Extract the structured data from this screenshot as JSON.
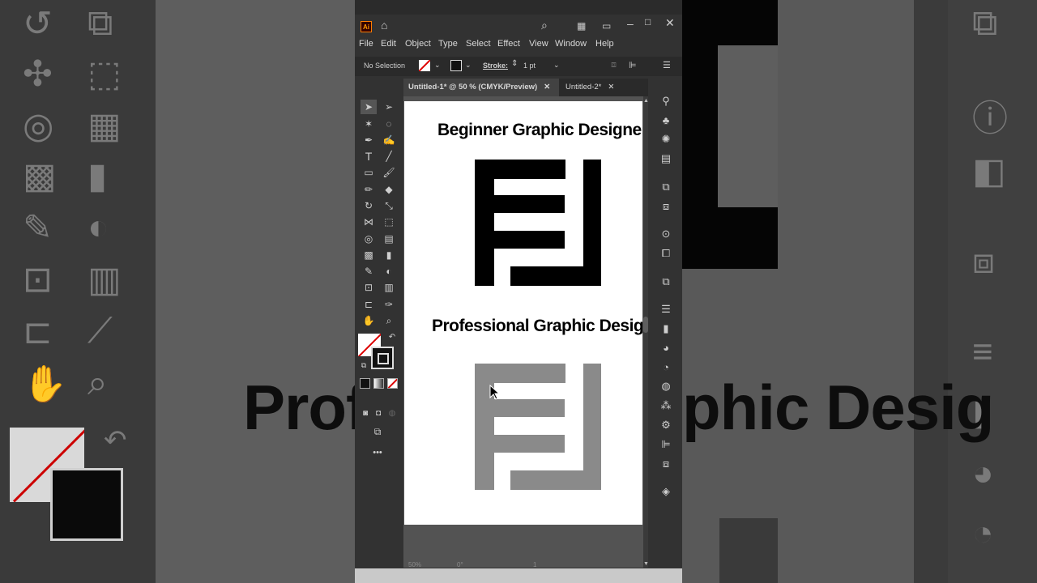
{
  "app": {
    "logo_text": "Ai",
    "menu": [
      "File",
      "Edit",
      "Object",
      "Type",
      "Select",
      "Effect",
      "View",
      "Window",
      "Help"
    ],
    "control_bar": {
      "selection_label": "No Selection",
      "stroke_label": "Stroke:",
      "stroke_value": "1 pt"
    },
    "tabs": [
      {
        "label": "Untitled-1* @ 50 % (CMYK/Preview)",
        "active": true
      },
      {
        "label": "Untitled-2*",
        "active": false
      }
    ],
    "status": {
      "zoom": "50%",
      "angle": "0°",
      "artboard": "1"
    },
    "more_tools": "•••"
  },
  "artboard": {
    "heading_beginner": "Beginner Graphic Designer",
    "heading_professional": "Professional Graphic Designer",
    "logo_beginner_color": "#000000",
    "logo_professional_color": "#8a8a8a"
  },
  "background": {
    "big_text_left": "Profe",
    "big_text_right": "phic Desig"
  },
  "colors": {
    "accent": "#ff7c00",
    "panel": "#323232",
    "canvas": "#535353"
  }
}
